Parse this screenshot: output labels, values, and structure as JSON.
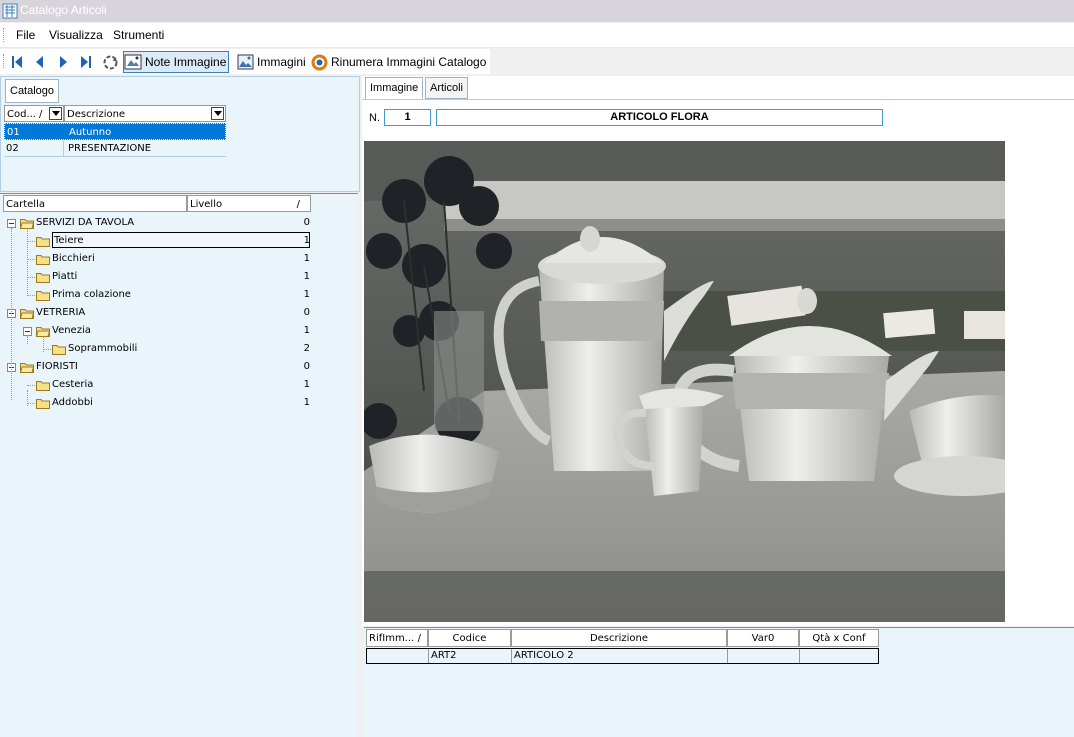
{
  "window": {
    "title": "Catalogo Articoli"
  },
  "menu": [
    "File",
    "Visualizza",
    "Strumenti"
  ],
  "toolbar": {
    "nav_icons": [
      "first-record-icon",
      "previous-record-icon",
      "next-record-icon",
      "last-record-icon",
      "refresh-icon"
    ],
    "note_immagine": "Note Immagine",
    "immagini": "Immagini",
    "rinumera": "Rinumera Immagini Catalogo"
  },
  "catalog": {
    "tab": "Catalogo",
    "columns": [
      "Cod...",
      "Descrizione"
    ],
    "sort_mark": "/",
    "rows": [
      {
        "code": "01",
        "desc": "Autunno",
        "selected": true
      },
      {
        "code": "02",
        "desc": "PRESENTAZIONE",
        "selected": false
      }
    ]
  },
  "tree": {
    "columns": [
      "Cartella",
      "Livello"
    ],
    "sort_mark": "/",
    "nodes": [
      {
        "label": "SERVIZI DA TAVOLA",
        "level": "0"
      },
      {
        "label": "Teiere",
        "level": "1"
      },
      {
        "label": "Bicchieri",
        "level": "1"
      },
      {
        "label": "Piatti",
        "level": "1"
      },
      {
        "label": "Prima colazione",
        "level": "1"
      },
      {
        "label": "VETRERIA",
        "level": "0"
      },
      {
        "label": "Venezia",
        "level": "1"
      },
      {
        "label": "Soprammobili",
        "level": "2"
      },
      {
        "label": "FIORISTI",
        "level": "0"
      },
      {
        "label": "Cesteria",
        "level": "1"
      },
      {
        "label": "Addobbi",
        "level": "1"
      }
    ]
  },
  "right_tabs": [
    "Immagine",
    "Articoli"
  ],
  "image_header": {
    "n_label": "N.",
    "number": "1",
    "title": "ARTICOLO FLORA"
  },
  "articles": {
    "columns": [
      "RifImm...",
      "Codice",
      "Descrizione",
      "Var0",
      "Qtà x Conf"
    ],
    "sort_mark": "/",
    "rows": [
      {
        "rif": "",
        "codice": "ART2",
        "descrizione": "ARTICOLO 2",
        "var0": "",
        "qta": ""
      }
    ]
  },
  "colors": {
    "selection": "#0078d7",
    "panel_bg": "#eaf4fb",
    "field_border": "#3a9ed0"
  }
}
